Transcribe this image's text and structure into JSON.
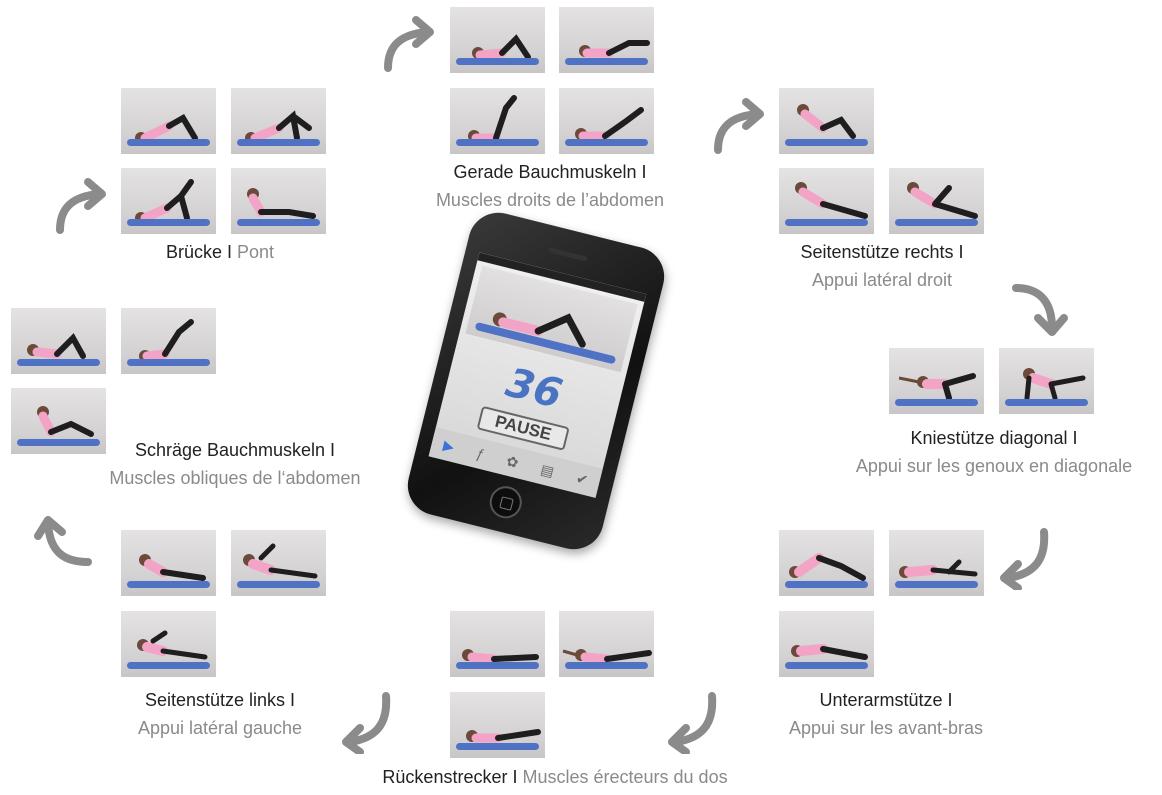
{
  "phone": {
    "counter": "36",
    "pause_label": "PAUSE",
    "tabs": [
      "▶",
      "ƒ",
      "✿",
      "▤",
      "✔"
    ]
  },
  "groups": {
    "gerade": {
      "de": "Gerade Bauchmuskeln I",
      "fr": "Muscles droits de l’abdomen"
    },
    "bruecke": {
      "de": "Brücke I",
      "fr": "Pont"
    },
    "seiten_rechts": {
      "de": "Seitenstütze rechts I",
      "fr": "Appui latéral droit"
    },
    "schraege": {
      "de": "Schräge Bauchmuskeln I",
      "fr": "Muscles obliques de l‘abdomen"
    },
    "knie": {
      "de": "Kniestütze diagonal I",
      "fr": "Appui sur les genoux en diagonale"
    },
    "seiten_links": {
      "de": "Seitenstütze links I",
      "fr": "Appui latéral gauche"
    },
    "unterarm": {
      "de": "Unterarmstütze I",
      "fr": "Appui sur les avant-bras"
    },
    "ruecken": {
      "de": "Rückenstrecker I",
      "fr": "Muscles érecteurs du dos"
    }
  },
  "colors": {
    "mat": "#4f72c4",
    "shirt": "#f2a3c6",
    "pants": "#1e1e1e",
    "arrow": "#8b8b8b",
    "label_de": "#222222",
    "label_fr": "#8a8a8a",
    "counter": "#4a74c2"
  },
  "icons": [
    "curved-arrow-icon"
  ]
}
